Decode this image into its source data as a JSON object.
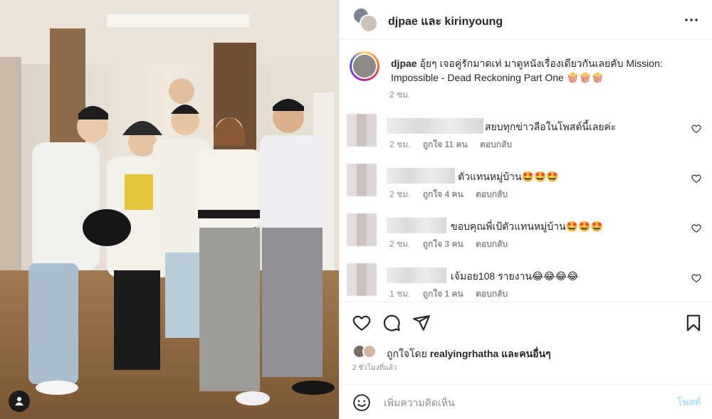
{
  "post": {
    "header": {
      "user_a": "djpae",
      "and_word": "และ",
      "user_b": "kirinyoung"
    },
    "caption": {
      "username": "djpae",
      "text": "อุ้ยๆ เจอคู่รักมาดเท่ มาดูหนังเรื่องเดียวกันเลยคับ Mission: Impossible - Dead Reckoning Part One 🍿🍿🍿",
      "time": "2 ชม."
    },
    "comments": [
      {
        "text": "สยบทุกข่าวลือในโพสต์นี้เลยค่ะ",
        "time": "2 ชม.",
        "likes": "ถูกใจ 11 คน",
        "reply": "ตอบกลับ"
      },
      {
        "text": "ตัวแทนหมู่บ้าน🤩🤩🤩",
        "time": "2 ชม.",
        "likes": "ถูกใจ 4 คน",
        "reply": "ตอบกลับ"
      },
      {
        "text": "ขอบคุณพี่เป้ตัวแทนหมู่บ้าน🤩🤩🤩",
        "time": "2 ชม.",
        "likes": "ถูกใจ 3 คน",
        "reply": "ตอบกลับ"
      },
      {
        "text": "เจ้มอย108 รายงาน😂😂😂😂",
        "time": "1 ชม.",
        "likes": "ถูกใจ 1 คน",
        "reply": "ตอบกลับ"
      }
    ],
    "likes": {
      "prefix": "ถูกใจโดย",
      "user": "realyingrhatha",
      "suffix": "และคนอื่นๆ"
    },
    "timestamp": "2 ชั่วโมงที่แล้ว",
    "comment_box": {
      "placeholder": "เพิ่มความคิดเห็น",
      "post_label": "โพสต์"
    }
  },
  "icons": {
    "more": "more-horizontal-icon",
    "like": "heart-icon",
    "comment": "comment-bubble-icon",
    "share": "paper-plane-icon",
    "save": "bookmark-icon",
    "emoji": "smiley-icon",
    "user_tag": "person-icon"
  },
  "colors": {
    "link_disabled": "#b2dffc",
    "muted": "#8e8e8e",
    "text": "#262626"
  }
}
